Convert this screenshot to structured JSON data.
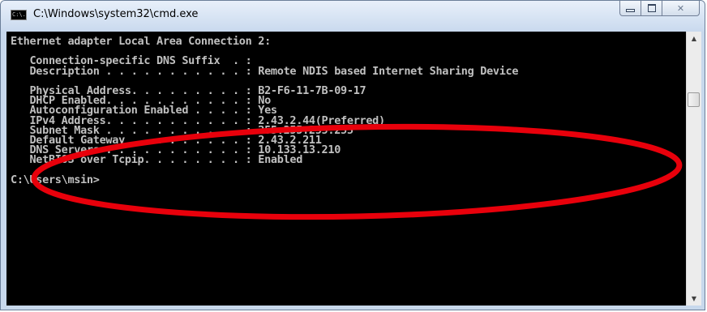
{
  "window": {
    "title": "C:\\Windows\\system32\\cmd.exe",
    "icon": "cmd-icon",
    "icon_text": "C:\\.",
    "controls": [
      "minimize-icon",
      "maximize-icon",
      "close-icon"
    ],
    "close_glyph": "✕"
  },
  "console": {
    "text_color": "#c0c0c0",
    "background": "#000000",
    "lines": [
      "Ethernet adapter Local Area Connection 2:",
      "",
      "   Connection-specific DNS Suffix  . :",
      "   Description . . . . . . . . . . . : Remote NDIS based Internet Sharing Device",
      "",
      "   Physical Address. . . . . . . . . : B2-F6-11-7B-09-17",
      "   DHCP Enabled. . . . . . . . . . . : No",
      "   Autoconfiguration Enabled . . . . : Yes",
      "   IPv4 Address. . . . . . . . . . . : 2.43.2.44(Preferred)",
      "   Subnet Mask . . . . . . . . . . . : 255.255.255.255",
      "   Default Gateway . . . . . . . . . : 2.43.2.211",
      "   DNS Servers . . . . . . . . . . . : 10.133.13.210",
      "   NetBIOS over Tcpip. . . . . . . . : Enabled",
      "",
      "C:\\Users\\msin>"
    ]
  },
  "scrollbar": {
    "up_icon": "scroll-up-arrow-icon",
    "down_icon": "scroll-down-arrow-icon",
    "up_glyph": "▲",
    "down_glyph": "▼"
  },
  "annotation": {
    "shape": "ellipse",
    "color": "#e8000b"
  }
}
